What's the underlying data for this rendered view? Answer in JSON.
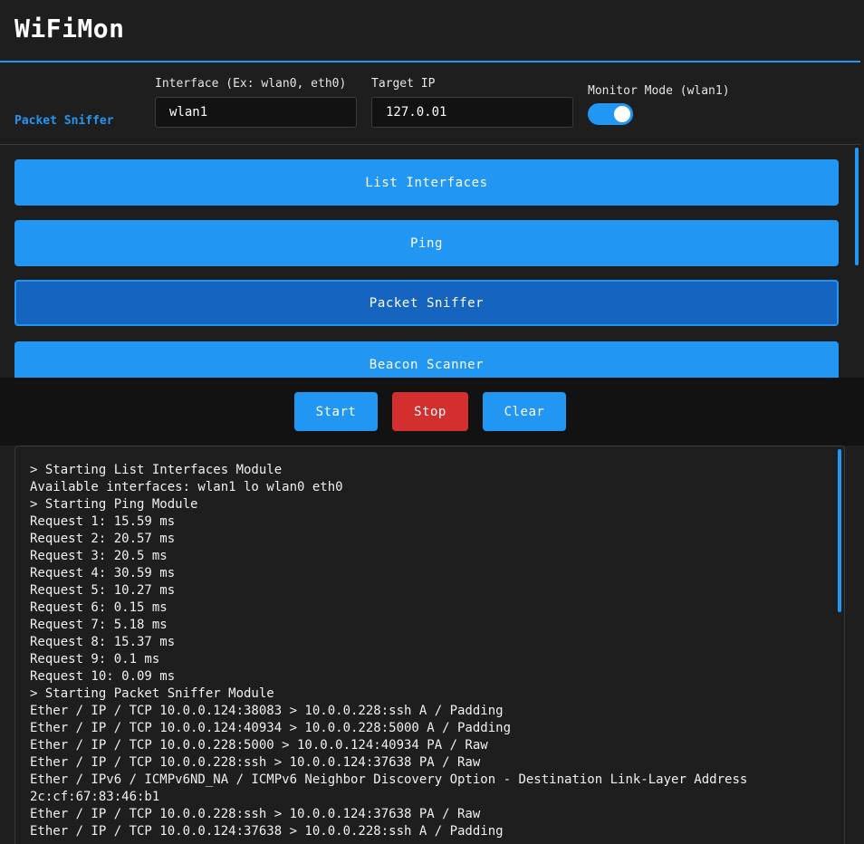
{
  "header": {
    "title": "WiFiMon"
  },
  "controls": {
    "module_label": "Packet Sniffer",
    "interface_label": "Interface (Ex: wlan0, eth0)",
    "interface_value": "wlan1",
    "target_label": "Target IP",
    "target_value": "127.0.01",
    "monitor_label": "Monitor Mode (wlan1)",
    "monitor_enabled": true
  },
  "modules": [
    {
      "label": "List Interfaces",
      "active": false
    },
    {
      "label": "Ping",
      "active": false
    },
    {
      "label": "Packet Sniffer",
      "active": true
    },
    {
      "label": "Beacon Scanner",
      "active": false
    }
  ],
  "actions": {
    "start_label": "Start",
    "stop_label": "Stop",
    "clear_label": "Clear"
  },
  "console": {
    "lines": [
      "> Starting List Interfaces Module",
      "Available interfaces: wlan1 lo wlan0 eth0",
      "> Starting Ping Module",
      "Request 1: 15.59 ms",
      "Request 2: 20.57 ms",
      "Request 3: 20.5 ms",
      "Request 4: 30.59 ms",
      "Request 5: 10.27 ms",
      "Request 6: 0.15 ms",
      "Request 7: 5.18 ms",
      "Request 8: 15.37 ms",
      "Request 9: 0.1 ms",
      "Request 10: 0.09 ms",
      "> Starting Packet Sniffer Module",
      "Ether / IP / TCP 10.0.0.124:38083 > 10.0.0.228:ssh A / Padding",
      "Ether / IP / TCP 10.0.0.124:40934 > 10.0.0.228:5000 A / Padding",
      "Ether / IP / TCP 10.0.0.228:5000 > 10.0.0.124:40934 PA / Raw",
      "Ether / IP / TCP 10.0.0.228:ssh > 10.0.0.124:37638 PA / Raw",
      "Ether / IPv6 / ICMPv6ND_NA / ICMPv6 Neighbor Discovery Option - Destination Link-Layer Address",
      "2c:cf:67:83:46:b1",
      "Ether / IP / TCP 10.0.0.228:ssh > 10.0.0.124:37638 PA / Raw",
      "Ether / IP / TCP 10.0.0.124:37638 > 10.0.0.228:ssh A / Padding"
    ]
  },
  "colors": {
    "accent": "#2196f3",
    "active_module": "#1565c0",
    "stop": "#d32f2f",
    "background": "#1e1e1e",
    "panel_dark": "#121212"
  }
}
